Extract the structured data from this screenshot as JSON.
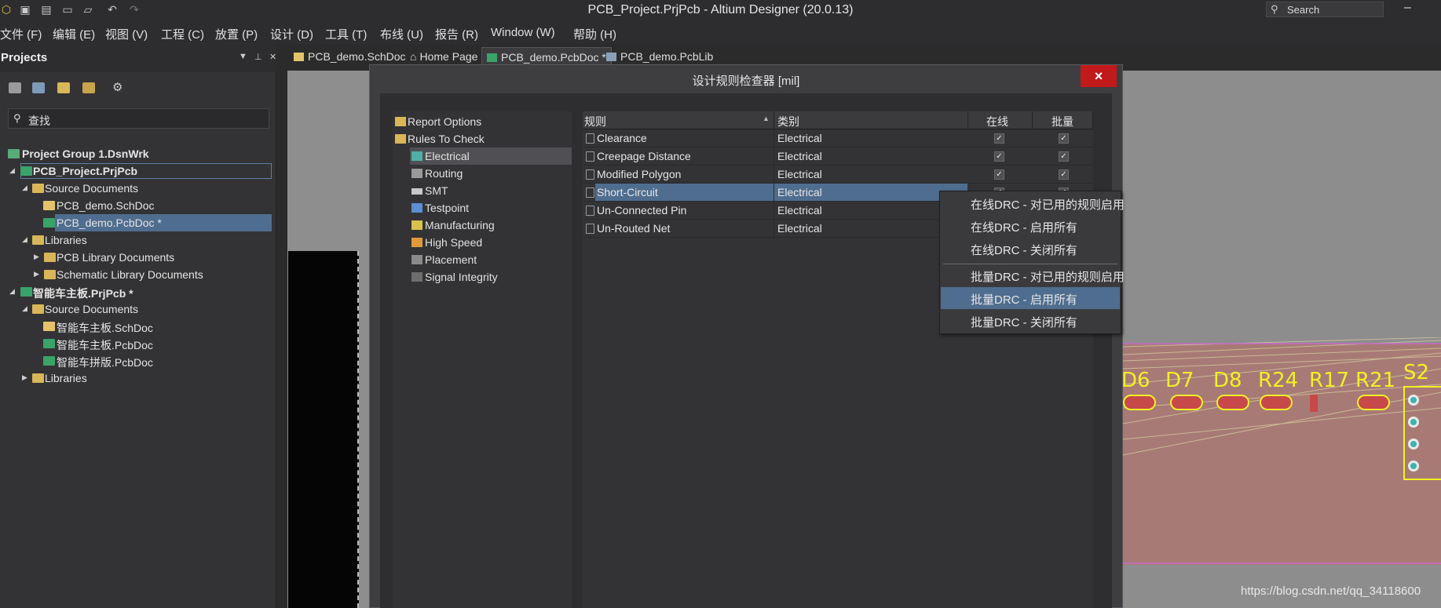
{
  "window": {
    "title": "PCB_Project.PrjPcb - Altium Designer (20.0.13)",
    "search_text": "Search"
  },
  "menu": [
    {
      "label": "文件 (F)"
    },
    {
      "label": "编辑 (E)"
    },
    {
      "label": "视图 (V)"
    },
    {
      "label": "工程 (C)"
    },
    {
      "label": "放置 (P)"
    },
    {
      "label": "设计 (D)"
    },
    {
      "label": "工具 (T)"
    },
    {
      "label": "布线 (U)"
    },
    {
      "label": "报告 (R)"
    },
    {
      "label": "Window (W)"
    },
    {
      "label": "帮助 (H)"
    }
  ],
  "projects_panel": {
    "title": "Projects",
    "search_value": "查找",
    "tree": [
      {
        "label": "Project Group 1.DsnWrk"
      },
      {
        "label": "PCB_Project.PrjPcb"
      },
      {
        "label": "Source Documents"
      },
      {
        "label": "PCB_demo.SchDoc"
      },
      {
        "label": "PCB_demo.PcbDoc *"
      },
      {
        "label": "Libraries"
      },
      {
        "label": "PCB Library Documents"
      },
      {
        "label": "Schematic Library Documents"
      },
      {
        "label": "智能车主板.PrjPcb *"
      },
      {
        "label": "Source Documents"
      },
      {
        "label": "智能车主板.SchDoc"
      },
      {
        "label": "智能车主板.PcbDoc"
      },
      {
        "label": "智能车拼版.PcbDoc"
      },
      {
        "label": "Libraries"
      }
    ]
  },
  "tabs": [
    {
      "label": "PCB_demo.SchDoc"
    },
    {
      "label": "Home Page"
    },
    {
      "label": "PCB_demo.PcbDoc *"
    },
    {
      "label": "PCB_demo.PcbLib"
    }
  ],
  "pcb": {
    "refs": [
      "D6",
      "D7",
      "D8",
      "R24",
      "R17",
      "R21",
      "S2"
    ],
    "colors": {
      "silkscreen": "#f2f024",
      "board": "#a87a76"
    }
  },
  "dialog": {
    "title": "设计规则检查器 [mil]",
    "close_icon": "×",
    "tree": [
      {
        "label": "Report Options"
      },
      {
        "label": "Rules To Check"
      },
      {
        "label": "Electrical"
      },
      {
        "label": "Routing"
      },
      {
        "label": "SMT"
      },
      {
        "label": "Testpoint"
      },
      {
        "label": "Manufacturing"
      },
      {
        "label": "High Speed"
      },
      {
        "label": "Placement"
      },
      {
        "label": "Signal Integrity"
      }
    ],
    "grid": {
      "headers": {
        "rule": "规则",
        "category": "类别",
        "online": "在线",
        "batch": "批量"
      },
      "rows": [
        {
          "rule": "Clearance",
          "category": "Electrical",
          "online": true,
          "batch": true
        },
        {
          "rule": "Creepage Distance",
          "category": "Electrical",
          "online": true,
          "batch": true
        },
        {
          "rule": "Modified Polygon",
          "category": "Electrical",
          "online": true,
          "batch": true
        },
        {
          "rule": "Short-Circuit",
          "category": "Electrical",
          "online": true,
          "batch": true
        },
        {
          "rule": "Un-Connected Pin",
          "category": "Electrical",
          "online": true,
          "batch": true
        },
        {
          "rule": "Un-Routed Net",
          "category": "Electrical",
          "online": true,
          "batch": true
        }
      ]
    }
  },
  "context_menu": {
    "items": [
      {
        "label": "在线DRC - 对已用的规则启用"
      },
      {
        "label": "在线DRC - 启用所有"
      },
      {
        "label": "在线DRC - 关闭所有"
      },
      {
        "label": "批量DRC - 对已用的规则启用"
      },
      {
        "label": "批量DRC - 启用所有"
      },
      {
        "label": "批量DRC - 关闭所有"
      }
    ]
  },
  "watermark": "https://blog.csdn.net/qq_34118600"
}
